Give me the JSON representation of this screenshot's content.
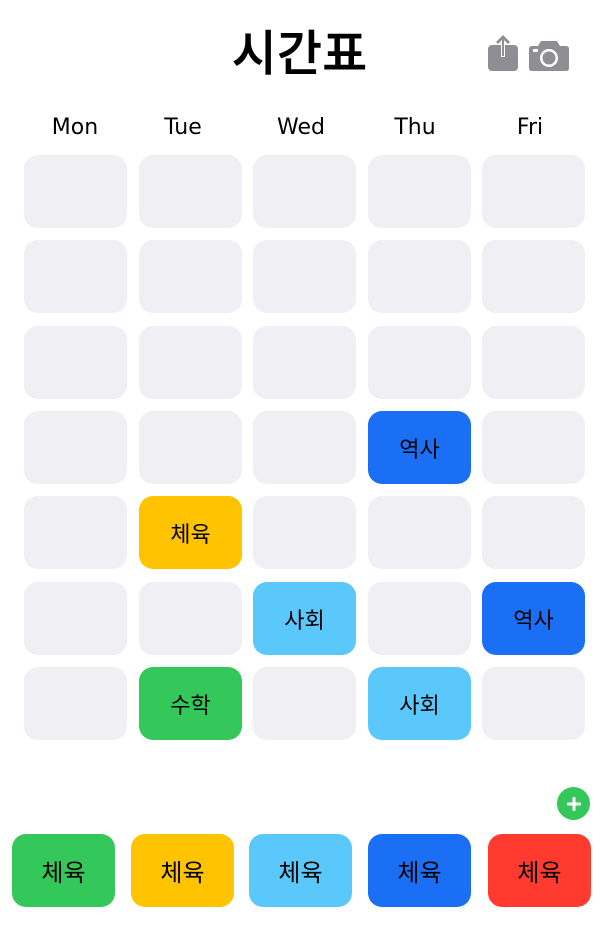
{
  "header": {
    "title": "시간표",
    "share_icon": "share-icon",
    "camera_icon": "camera-icon"
  },
  "days": [
    "Mon",
    "Tue",
    "Wed",
    "Thu",
    "Fri"
  ],
  "colors": {
    "empty": "#efeff4",
    "green": "#34c759",
    "yellow": "#ffc300",
    "light_blue": "#5ac8fa",
    "blue": "#1a6ff5",
    "red": "#ff3b30"
  },
  "timetable": [
    [
      {
        "label": ""
      },
      {
        "label": ""
      },
      {
        "label": ""
      },
      {
        "label": ""
      },
      {
        "label": ""
      }
    ],
    [
      {
        "label": ""
      },
      {
        "label": ""
      },
      {
        "label": ""
      },
      {
        "label": ""
      },
      {
        "label": ""
      }
    ],
    [
      {
        "label": ""
      },
      {
        "label": ""
      },
      {
        "label": ""
      },
      {
        "label": ""
      },
      {
        "label": ""
      }
    ],
    [
      {
        "label": ""
      },
      {
        "label": ""
      },
      {
        "label": ""
      },
      {
        "label": "역사",
        "color": "#1a6ff5"
      },
      {
        "label": ""
      }
    ],
    [
      {
        "label": ""
      },
      {
        "label": "체육",
        "color": "#ffc300"
      },
      {
        "label": ""
      },
      {
        "label": ""
      },
      {
        "label": ""
      }
    ],
    [
      {
        "label": ""
      },
      {
        "label": ""
      },
      {
        "label": "사회",
        "color": "#5ac8fa"
      },
      {
        "label": ""
      },
      {
        "label": "역사",
        "color": "#1a6ff5"
      }
    ],
    [
      {
        "label": ""
      },
      {
        "label": "수학",
        "color": "#34c759"
      },
      {
        "label": ""
      },
      {
        "label": "사회",
        "color": "#5ac8fa"
      },
      {
        "label": ""
      }
    ]
  ],
  "add_icon": "plus-icon",
  "palette": [
    {
      "label": "체육",
      "color": "#34c759"
    },
    {
      "label": "체육",
      "color": "#ffc300"
    },
    {
      "label": "체육",
      "color": "#5ac8fa"
    },
    {
      "label": "체육",
      "color": "#1a6ff5"
    },
    {
      "label": "체육",
      "color": "#ff3b30"
    }
  ]
}
